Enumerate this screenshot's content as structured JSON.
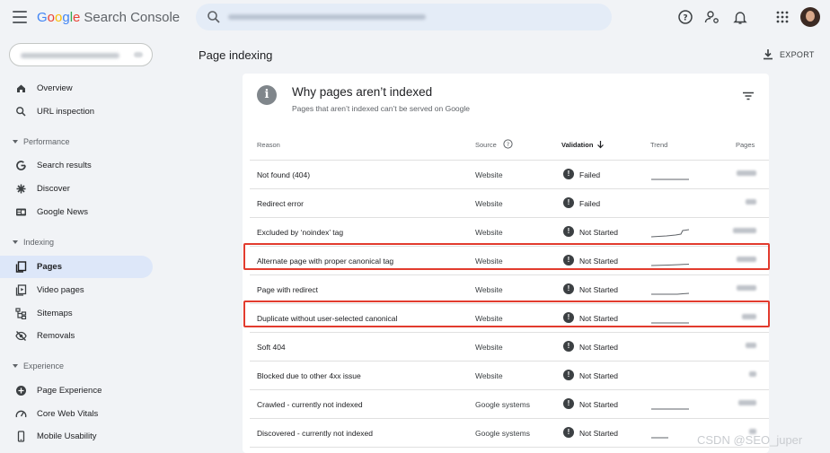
{
  "header": {
    "logo_google": [
      "G",
      "o",
      "o",
      "g",
      "l",
      "e"
    ],
    "logo_product": "Search Console",
    "search_placeholder": "",
    "icons": [
      "help-icon",
      "manage-users-icon",
      "notifications-icon",
      "apps-icon"
    ]
  },
  "sidebar": {
    "items": [
      {
        "label": "Overview",
        "icon": "home-icon"
      },
      {
        "label": "URL inspection",
        "icon": "search-icon"
      }
    ],
    "performance": {
      "title": "Performance",
      "items": [
        {
          "label": "Search results",
          "icon": "google-g-icon"
        },
        {
          "label": "Discover",
          "icon": "asterisk-icon"
        },
        {
          "label": "Google News",
          "icon": "news-icon"
        }
      ]
    },
    "indexing": {
      "title": "Indexing",
      "items": [
        {
          "label": "Pages",
          "icon": "pages-icon",
          "active": true
        },
        {
          "label": "Video pages",
          "icon": "video-pages-icon"
        },
        {
          "label": "Sitemaps",
          "icon": "sitemap-icon"
        },
        {
          "label": "Removals",
          "icon": "removals-icon"
        }
      ]
    },
    "experience": {
      "title": "Experience",
      "items": [
        {
          "label": "Page Experience",
          "icon": "page-experience-icon"
        },
        {
          "label": "Core Web Vitals",
          "icon": "speedometer-icon"
        },
        {
          "label": "Mobile Usability",
          "icon": "phone-icon"
        }
      ]
    }
  },
  "main": {
    "title": "Page indexing",
    "export_label": "EXPORT"
  },
  "card": {
    "title": "Why pages aren’t indexed",
    "subtitle": "Pages that aren’t indexed can’t be served on Google",
    "columns": {
      "reason": "Reason",
      "source": "Source",
      "validation": "Validation",
      "trend": "Trend",
      "pages": "Pages"
    },
    "rows": [
      {
        "reason": "Not found (404)",
        "source": "Website",
        "validation": "Failed",
        "highlighted": false
      },
      {
        "reason": "Redirect error",
        "source": "Website",
        "validation": "Failed",
        "highlighted": false
      },
      {
        "reason": "Excluded by ‘noindex’ tag",
        "source": "Website",
        "validation": "Not Started",
        "highlighted": false
      },
      {
        "reason": "Alternate page with proper canonical tag",
        "source": "Website",
        "validation": "Not Started",
        "highlighted": true
      },
      {
        "reason": "Page with redirect",
        "source": "Website",
        "validation": "Not Started",
        "highlighted": false
      },
      {
        "reason": "Duplicate without user-selected canonical",
        "source": "Website",
        "validation": "Not Started",
        "highlighted": true
      },
      {
        "reason": "Soft 404",
        "source": "Website",
        "validation": "Not Started",
        "highlighted": false
      },
      {
        "reason": "Blocked due to other 4xx issue",
        "source": "Website",
        "validation": "Not Started",
        "highlighted": false
      },
      {
        "reason": "Crawled - currently not indexed",
        "source": "Google systems",
        "validation": "Not Started",
        "highlighted": false
      },
      {
        "reason": "Discovered - currently not indexed",
        "source": "Google systems",
        "validation": "Not Started",
        "highlighted": false
      }
    ]
  },
  "watermark": "CSDN @SEO_juper",
  "colors": {
    "accent": "#1a73e8",
    "active_nav": "#dde7f9",
    "highlight_border": "#e23b2e",
    "page_bg": "#f1f3f6"
  }
}
